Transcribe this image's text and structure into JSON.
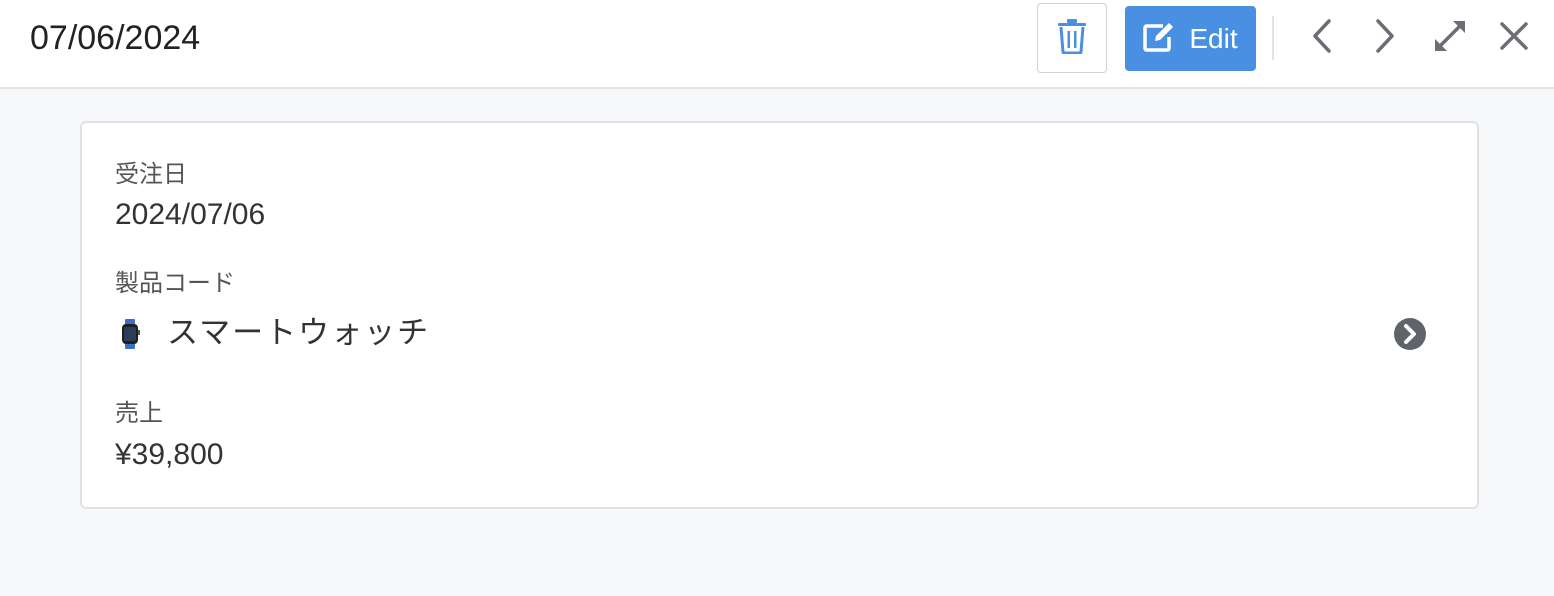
{
  "header": {
    "title": "07/06/2024",
    "edit_label": "Edit",
    "icons": {
      "delete": "trash-icon",
      "edit": "edit-icon",
      "prev": "chevron-left-icon",
      "next": "chevron-right-icon",
      "expand": "expand-icon",
      "close": "close-icon"
    }
  },
  "colors": {
    "accent": "#4a90e2",
    "background": "#f7f8fa",
    "icon_gray": "#6b6f75"
  },
  "record": {
    "order_date": {
      "label": "受注日",
      "value": "2024/07/06"
    },
    "product_code": {
      "label": "製品コード",
      "value": "スマートウォッチ",
      "icon": "smartwatch-icon",
      "link_icon": "arrow-circle-right-icon"
    },
    "sales": {
      "label": "売上",
      "value": "¥39,800"
    }
  }
}
